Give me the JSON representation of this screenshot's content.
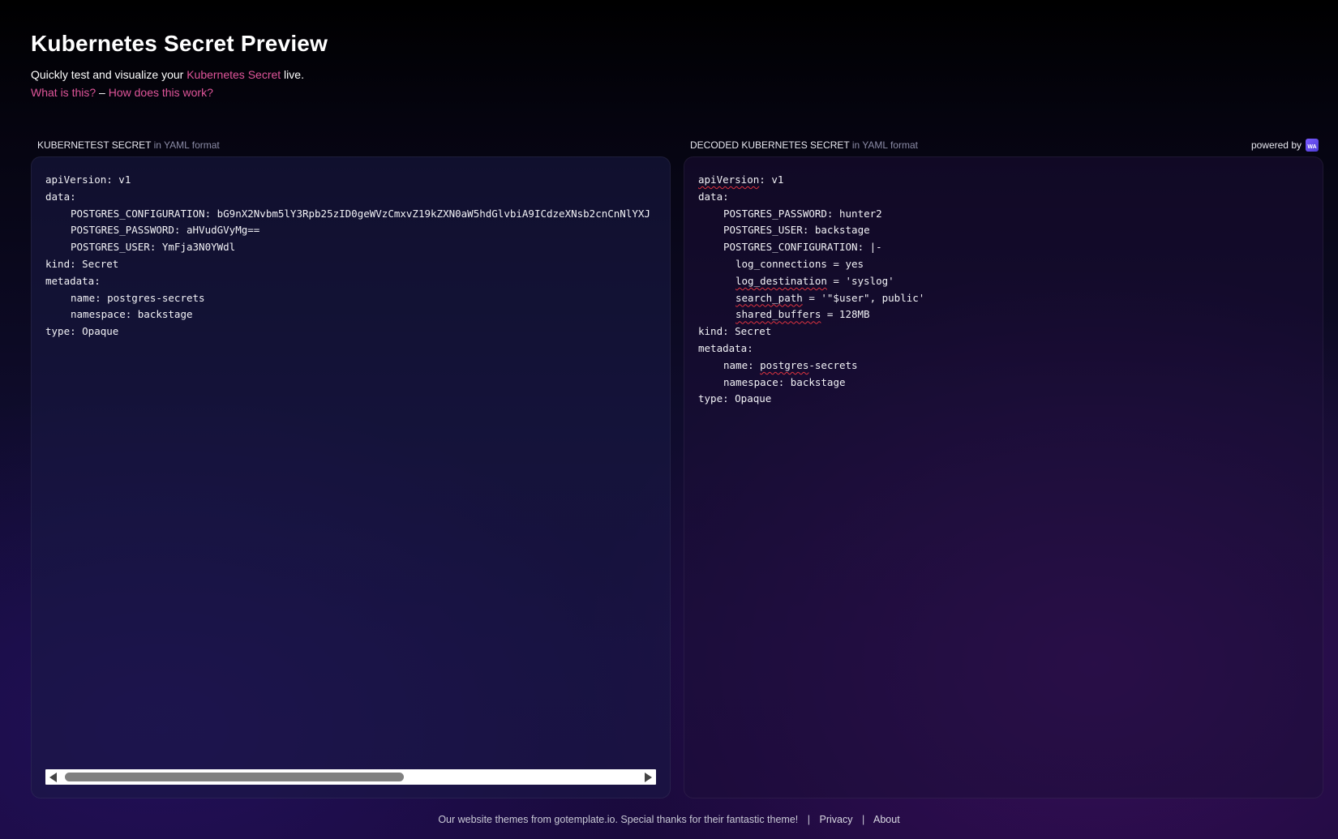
{
  "header": {
    "title": "Kubernetes Secret Preview",
    "subtitle_prefix": "Quickly test and visualize your ",
    "subtitle_link": "Kubernetes Secret",
    "subtitle_suffix": " live.",
    "what_link": "What is this?",
    "dash": " – ",
    "how_link": "How does this work?"
  },
  "left_panel": {
    "label": "KUBERNETEST SECRET",
    "label_suffix": " in YAML format",
    "lines": [
      {
        "indent": 0,
        "text": "apiVersion: v1"
      },
      {
        "indent": 0,
        "text": "data:"
      },
      {
        "indent": 1,
        "text": "POSTGRES_CONFIGURATION: bG9nX2Nvbm5lY3Rpb25zID0geWVzCmxvZ19kZXN0aW5hdGlvbiA9ICdzeXNsb2cnCnNlYXJ"
      },
      {
        "indent": 1,
        "text": "POSTGRES_PASSWORD: aHVudGVyMg=="
      },
      {
        "indent": 1,
        "text": "POSTGRES_USER: YmFja3N0YWdl"
      },
      {
        "indent": 0,
        "text": "kind: Secret"
      },
      {
        "indent": 0,
        "text": "metadata:"
      },
      {
        "indent": 1,
        "text": "name: postgres-secrets"
      },
      {
        "indent": 1,
        "text": "namespace: backstage"
      },
      {
        "indent": 0,
        "text": "type: Opaque"
      }
    ]
  },
  "right_panel": {
    "label": "DECODED KUBERNETES SECRET",
    "label_suffix": " in YAML format",
    "powered_by": "powered by",
    "logo_text": "WA",
    "lines": [
      {
        "indent": 0,
        "mark": "apiVersion",
        "rest": ": v1"
      },
      {
        "indent": 0,
        "mark": "",
        "rest": "data:"
      },
      {
        "indent": 1,
        "mark": "",
        "rest": "POSTGRES_PASSWORD: hunter2"
      },
      {
        "indent": 1,
        "mark": "",
        "rest": "POSTGRES_USER: backstage"
      },
      {
        "indent": 1,
        "mark": "",
        "rest": "POSTGRES_CONFIGURATION: |-"
      },
      {
        "indent": 2,
        "mark": "",
        "rest": "log_connections = yes"
      },
      {
        "indent": 2,
        "mark": "log_destination",
        "rest": " = 'syslog'"
      },
      {
        "indent": 2,
        "mark": "search_path",
        "rest": " = '\"$user\", public'"
      },
      {
        "indent": 2,
        "mark": "shared_buffers",
        "rest": " = 128MB"
      },
      {
        "indent": 0,
        "mark": "",
        "rest": "kind: Secret"
      },
      {
        "indent": 0,
        "mark": "",
        "rest": "metadata:"
      },
      {
        "indent": 1,
        "pre": "name: ",
        "mark": "postgres",
        "rest": "-secrets"
      },
      {
        "indent": 1,
        "mark": "",
        "rest": "namespace: backstage"
      },
      {
        "indent": 0,
        "mark": "",
        "rest": "type: Opaque"
      }
    ]
  },
  "footer": {
    "text": "Our website themes from gotemplate.io. Special thanks for their fantastic theme!",
    "privacy": "Privacy",
    "about": "About",
    "separator": "|"
  }
}
